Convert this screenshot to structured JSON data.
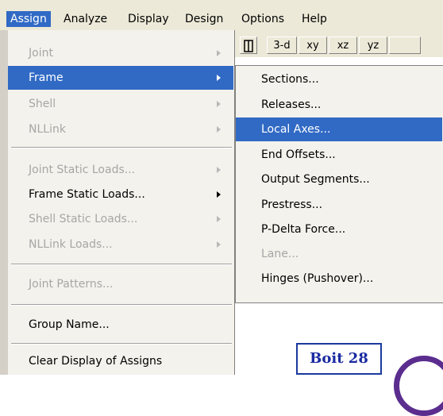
{
  "menubar": {
    "items": [
      "Assign",
      "Analyze",
      "Display",
      "Design",
      "Options",
      "Help"
    ]
  },
  "toolbar": {
    "buttons": [
      "3-d",
      "xy",
      "xz",
      "yz"
    ]
  },
  "assign_menu": {
    "items": [
      {
        "label": "Joint",
        "enabled": false,
        "submenu": true
      },
      {
        "label": "Frame",
        "enabled": true,
        "submenu": true,
        "highlighted": true
      },
      {
        "label": "Shell",
        "enabled": false,
        "submenu": true
      },
      {
        "label": "NLLink",
        "enabled": false,
        "submenu": true
      },
      {
        "label": "Joint Static Loads...",
        "enabled": false,
        "submenu": true
      },
      {
        "label": "Frame Static Loads...",
        "enabled": true,
        "submenu": true
      },
      {
        "label": "Shell Static Loads...",
        "enabled": false,
        "submenu": true
      },
      {
        "label": "NLLink Loads...",
        "enabled": false,
        "submenu": true
      },
      {
        "label": "Joint Patterns...",
        "enabled": false,
        "submenu": false
      },
      {
        "label": "Group Name...",
        "enabled": true,
        "submenu": false
      },
      {
        "label": "Clear Display of Assigns",
        "enabled": true,
        "submenu": false
      }
    ]
  },
  "frame_submenu": {
    "items": [
      {
        "label": "Sections...",
        "enabled": true
      },
      {
        "label": "Releases...",
        "enabled": true
      },
      {
        "label": "Local Axes...",
        "enabled": true,
        "highlighted": true
      },
      {
        "label": "End Offsets...",
        "enabled": true
      },
      {
        "label": "Output Segments...",
        "enabled": true
      },
      {
        "label": "Prestress...",
        "enabled": true
      },
      {
        "label": "P-Delta Force...",
        "enabled": true
      },
      {
        "label": "Lane...",
        "enabled": false
      },
      {
        "label": "Hinges (Pushover)...",
        "enabled": true
      }
    ]
  },
  "label_box": {
    "text": "Boit 28"
  },
  "colors": {
    "highlight": "#316ac5",
    "menu_bg": "#f4f2ec",
    "disabled_text": "#a6a6a6",
    "label_text": "#1a2aa0"
  }
}
